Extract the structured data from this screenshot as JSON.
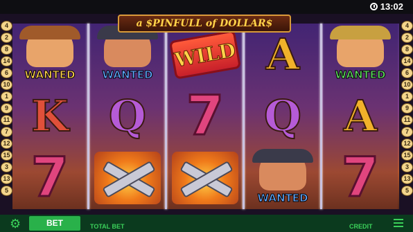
{
  "status_bar": {
    "time": "13:02"
  },
  "logo": {
    "text": "a $PINFULL of DOLLAR$"
  },
  "paylines_left": [
    "4",
    "2",
    "8",
    "14",
    "6",
    "10",
    "1",
    "9",
    "11",
    "7",
    "12",
    "15",
    "3",
    "13",
    "5"
  ],
  "paylines_right": [
    "4",
    "2",
    "8",
    "14",
    "6",
    "10",
    "1",
    "9",
    "11",
    "7",
    "12",
    "15",
    "3",
    "13",
    "5"
  ],
  "reels": [
    [
      {
        "type": "wanted",
        "label": "WANTED",
        "label_color": "#ffd34a",
        "face": "#e8a46a",
        "hat": "#a05a2a"
      },
      {
        "type": "letter",
        "value": "K",
        "cls": "K"
      },
      {
        "type": "seven",
        "value": "7"
      }
    ],
    [
      {
        "type": "wanted",
        "label": "WANTED",
        "label_color": "#5fa8ff",
        "face": "#d98a5e",
        "hat": "#3a3a4a"
      },
      {
        "type": "letter",
        "value": "Q",
        "cls": "Q"
      },
      {
        "type": "guns"
      }
    ],
    [
      {
        "type": "wild",
        "value": "WILD"
      },
      {
        "type": "seven",
        "value": "7"
      },
      {
        "type": "guns"
      }
    ],
    [
      {
        "type": "letter",
        "value": "A",
        "cls": "A"
      },
      {
        "type": "letter",
        "value": "Q",
        "cls": "Q"
      },
      {
        "type": "wanted",
        "label": "WANTED",
        "label_color": "#5fa8ff",
        "face": "#d98a5e",
        "hat": "#3a3a4a"
      }
    ],
    [
      {
        "type": "wanted",
        "label": "WANTED",
        "label_color": "#5fe05f",
        "face": "#e8a46a",
        "hat": "#c8a040"
      },
      {
        "type": "letter",
        "value": "A",
        "cls": "A"
      },
      {
        "type": "seven",
        "value": "7"
      }
    ]
  ],
  "bottom_bar": {
    "bet_label": "BET",
    "total_bet_label": "TOTAL BET",
    "credit_label": "CREDIT"
  }
}
